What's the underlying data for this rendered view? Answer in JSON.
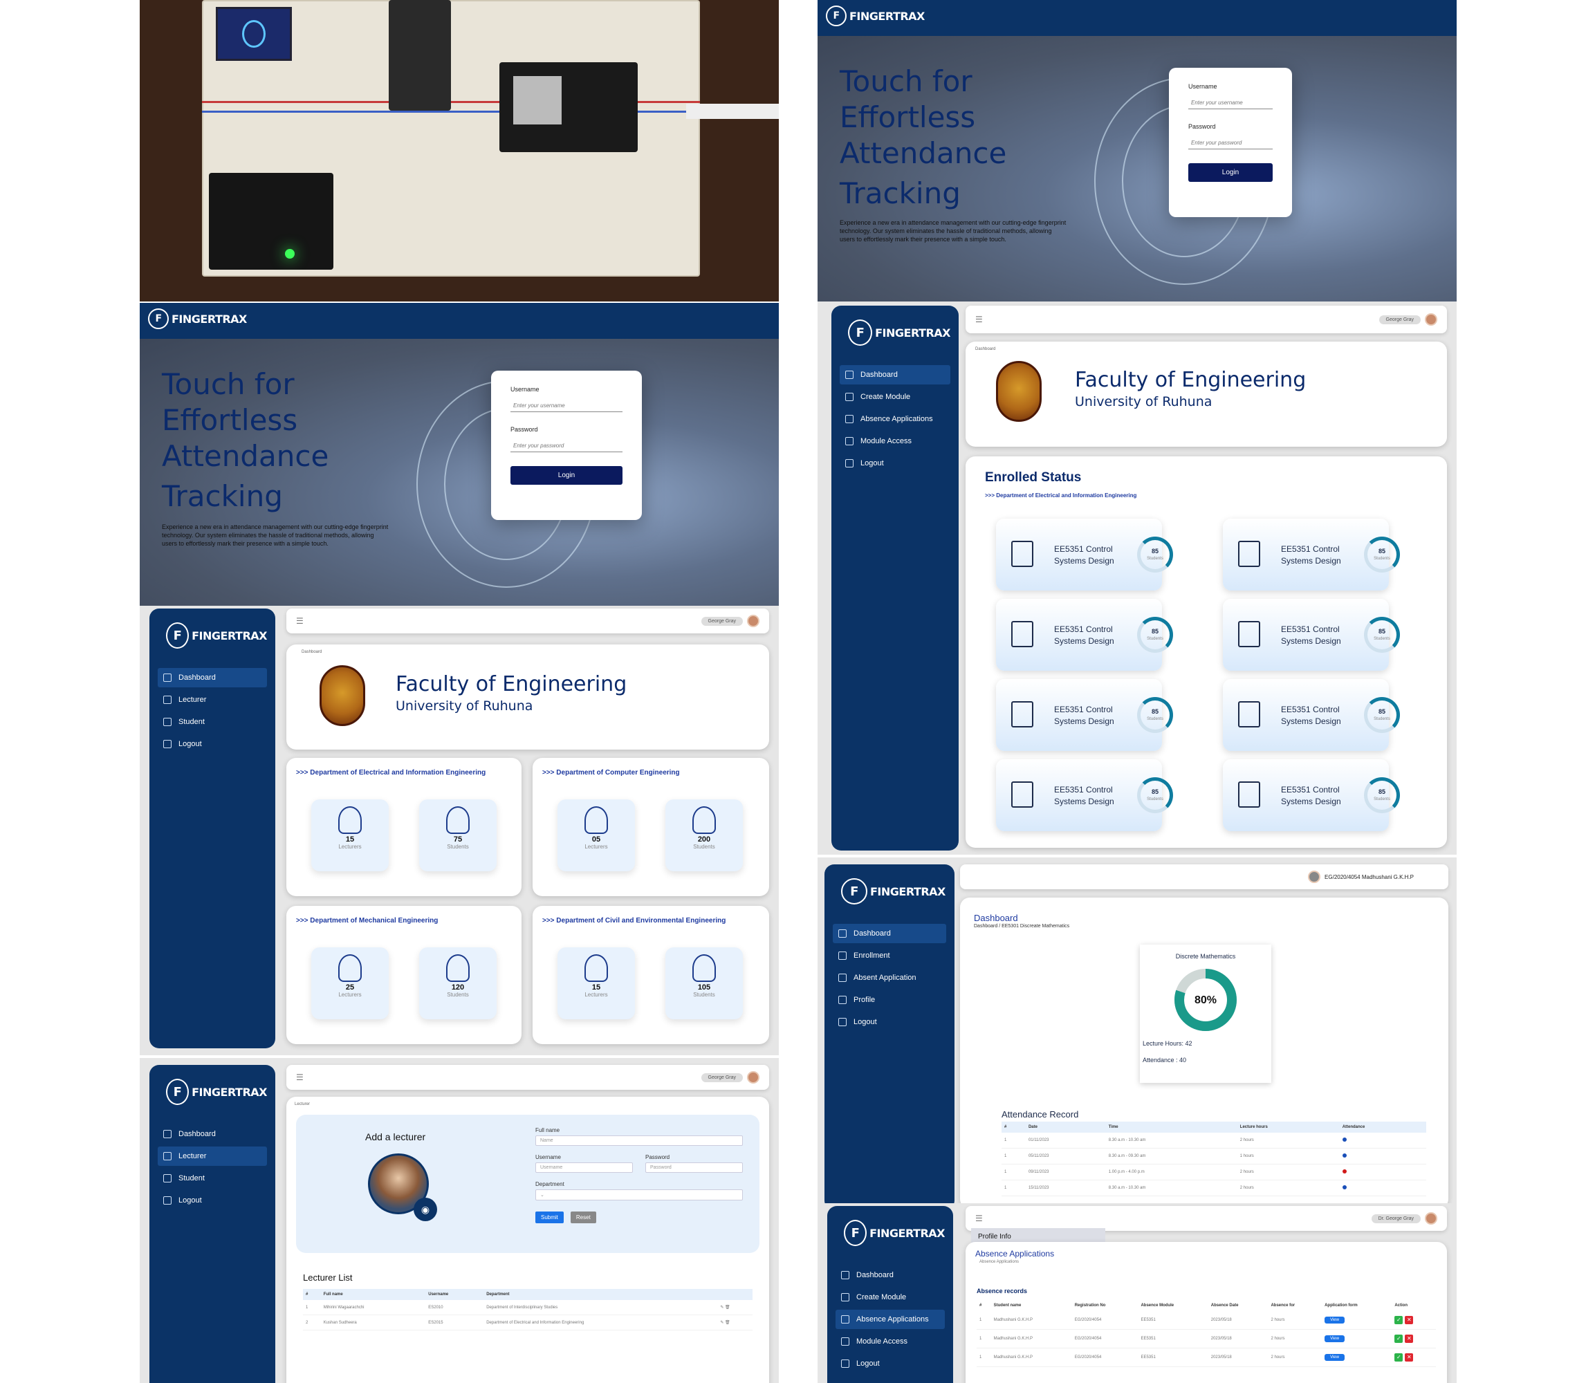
{
  "brand": "FINGERTRAX",
  "hero": {
    "line1": "Touch for",
    "line2": "Effortless",
    "line3": "Attendance",
    "line4": "Tracking",
    "desc": "Experience a new era in attendance management with our cutting-edge fingerprint technology. Our system eliminates the hassle of traditional methods, allowing users to effortlessly mark their presence with a simple touch."
  },
  "login": {
    "username_label": "Username",
    "username_placeholder": "Enter your username",
    "password_label": "Password",
    "password_placeholder": "Enter your password",
    "button": "Login"
  },
  "admin": {
    "nav": [
      "Dashboard",
      "Lecturer",
      "Student",
      "Logout"
    ],
    "user": "George Gray",
    "crumb": "Dashboard",
    "faculty": "Faculty of Engineering",
    "university": "University of Ruhuna",
    "departments": [
      {
        "name": ">>> Department of Electrical and Information Engineering",
        "lecturers": "15",
        "students": "75"
      },
      {
        "name": ">>> Department of Computer Engineering",
        "lecturers": "05",
        "students": "200"
      },
      {
        "name": ">>> Department of Mechanical Engineering",
        "lecturers": "25",
        "students": "120"
      },
      {
        "name": ">>> Department of Civil and Environmental Engineering",
        "lecturers": "15",
        "students": "105"
      }
    ],
    "lecturers_cap": "Lecturers",
    "students_cap": "Students"
  },
  "lecturer_page": {
    "crumb": "Lecturer",
    "add_title": "Add a lecturer",
    "full_name_label": "Full name",
    "name_ph": "Name",
    "username_label": "Username",
    "username_ph": "Username",
    "password_label": "Password",
    "password_ph": "Password",
    "department_label": "Department",
    "submit": "Submit",
    "reset": "Reset",
    "list_title": "Lecturer List",
    "columns": [
      "#",
      "Full name",
      "Username",
      "Department"
    ],
    "rows": [
      [
        "1",
        "Mihirini Wagaarachchi",
        "ES2010",
        "Department of Interdisciplinary Studies"
      ],
      [
        "2",
        "Kushan Sudheera",
        "ES2015",
        "Department of Electrical and Information Engineering"
      ]
    ]
  },
  "lect_dash": {
    "nav": [
      "Dashboard",
      "Create Module",
      "Absence Applications",
      "Module Access",
      "Logout"
    ],
    "user": "George Gray",
    "crumb": "Dashboard",
    "enrolled_title": "Enrolled Status",
    "dept": ">>> Department of Electrical and Information Engineering",
    "module_line1": "EE5351 Control",
    "module_line2": "Systems Design",
    "count": "85",
    "count_cap": "Students"
  },
  "student": {
    "user": "EG/2020/4054 Madhushani G.K.H.P",
    "nav": [
      "Dashboard",
      "Enrollment",
      "Absent Application",
      "Profile",
      "Logout"
    ],
    "title": "Dashboard",
    "crumb": "Dashboard / EE5301 Discreate Mathematics",
    "module": "Discrete Mathematics",
    "percent": "80%",
    "attendance_fraction": 0.8,
    "hours": "Lecture Hours: 42",
    "attendance": "Attendance : 40",
    "record_title": "Attendance Record",
    "columns": [
      "#",
      "Date",
      "Time",
      "Lecture hours",
      "Attendance"
    ],
    "rows": [
      [
        "1",
        "01/11/2023",
        "8.30 a.m - 10.30 am",
        "2 hours",
        "present"
      ],
      [
        "1",
        "05/11/2023",
        "8.30 a.m - 09.30 am",
        "1 hours",
        "present"
      ],
      [
        "1",
        "09/11/2023",
        "1.00 p.m - 4.00 p.m",
        "2 hours",
        "absent"
      ],
      [
        "1",
        "15/11/2023",
        "8.30 a.m - 10.30 am",
        "2 hours",
        "present"
      ]
    ],
    "colors": {
      "present": "#1a4fb8",
      "absent": "#d11a1a"
    }
  },
  "absence": {
    "nav": [
      "Dashboard",
      "Create Module",
      "Absence Applications",
      "Module Access",
      "Logout"
    ],
    "user": "Dr. George Gray",
    "popup": "Profile Info",
    "title": "Absence Applications",
    "crumb": "Absence Applications",
    "records": "Absence records",
    "columns": [
      "#",
      "Student name",
      "Registration No",
      "Absence Module",
      "Absence Date",
      "Absence for",
      "Application form",
      "Action"
    ],
    "rows": [
      [
        "1",
        "Madhushani G.K.H.P",
        "EG/2020/4054",
        "EE5351",
        "2023/05/18",
        "2 hours"
      ],
      [
        "1",
        "Madhushani G.K.H.P",
        "EG/2020/4054",
        "EE5351",
        "2023/05/18",
        "2 hours"
      ],
      [
        "1",
        "Madhushani G.K.H.P",
        "EG/2020/4054",
        "EE5351",
        "2023/05/18",
        "2 hours"
      ]
    ],
    "view": "View"
  }
}
